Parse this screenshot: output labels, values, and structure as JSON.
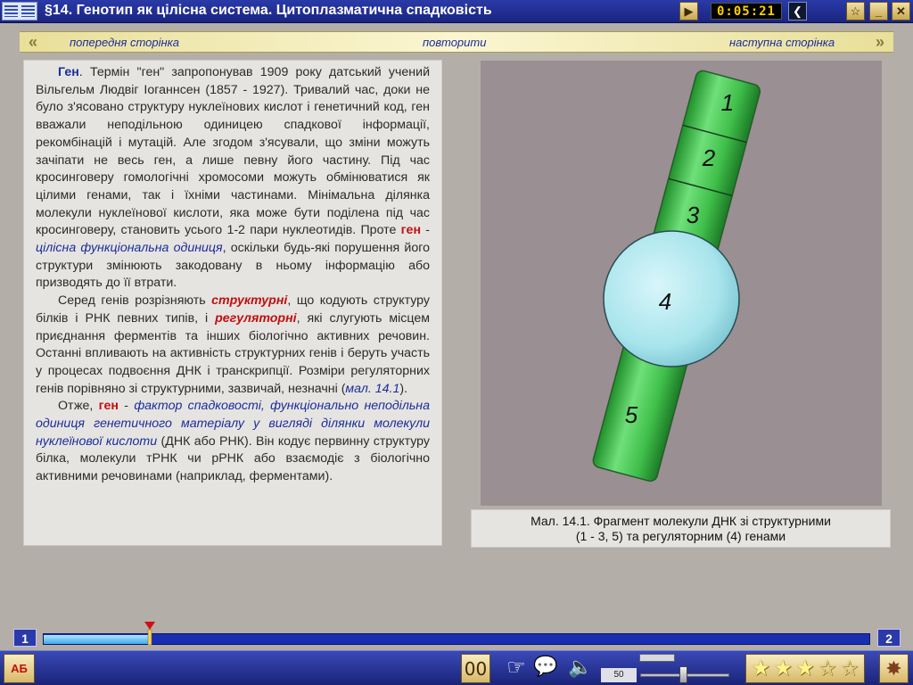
{
  "window": {
    "title": "§14. Генотип як цілісна система. Цитоплазматична спадковість",
    "timer": "0:05:21"
  },
  "nav": {
    "prev": "попередня сторінка",
    "repeat": "повторити",
    "next": "наступна сторінка"
  },
  "text": {
    "p1_gen": "Ген",
    "p1_a": ". Термін \"ген\" запропонував 1909 року датський учений Вільгельм Людвіг Іоганнсен (1857 - 1927). Тривалий час, доки не було з'ясовано структуру нуклеїнових кислот і генетичний код, ген вважали неподільною одиницею спадкової інформації, рекомбінацій і мутацій. Але згодом з'ясували, що зміни можуть зачіпати не весь ген, а лише певну його частину. Під час кросинговеру гомологічні хромосоми можуть обмінюватися як цілими генами, так і їхніми частинами. Мінімальна ділянка молекули нуклеїнової кислоти, яка може бути поділена під час кросинговеру, становить усього 1-2 пари нуклеотидів. Проте ",
    "p1_gen2": "ген",
    "p1_b": " - ",
    "p1_def": "цілісна функціональна одиниця",
    "p1_c": ", оскільки будь-які порушення його структури змінюють закодовану в ньому інформацію або призводять до її втрати.",
    "p2_a": "Серед генів розрізняють ",
    "p2_struct": "структурні",
    "p2_b": ", що кодують структуру білків і РНК певних типів, і ",
    "p2_reg": "регуляторні",
    "p2_c": ", які слугують місцем приєднання ферментів та інших біологічно активних речовин. Останні впливають на активність структурних генів і беруть участь у процесах подвоєння ДНК і транскрипції. Розміри регуляторних генів порівняно зі структурними, зазвичай, незначні (",
    "p2_ref": "мал. 14.1",
    "p2_d": ").",
    "p3_a": "Отже, ",
    "p3_gen": "ген",
    "p3_b": " - ",
    "p3_def": "фактор спадковості, функціонально неподільна одиниця генетичного матеріалу у вигляді ділянки молекули нуклеїнової кислоти",
    "p3_c": " (ДНК або РНК). Він кодує первинну структуру білка, молекули тРНК чи рРНК або взаємодіє з біологічно активними речовинами (наприклад, ферментами)."
  },
  "figure": {
    "segments": [
      "1",
      "2",
      "3",
      "4",
      "5"
    ],
    "caption_line1": "Мал. 14.1. Фрагмент молекули ДНК зі структурними",
    "caption_line2": "(1 - 3, 5) та регуляторним (4) генами"
  },
  "progress": {
    "start_page": "1",
    "end_page": "2",
    "fraction": 0.13
  },
  "toolbar": {
    "spell_label": "АБ",
    "counter": "00",
    "volume_value": "50",
    "stars_filled": 3,
    "stars_total": 5
  },
  "colors": {
    "title_bg": "#1a2480",
    "accent_blue": "#1a2d9a",
    "accent_red": "#c01010",
    "gene_green": "#3fbf4a",
    "regulator_cyan": "#a8e4ec",
    "figure_bg": "#9a8f92"
  },
  "icons": [
    "menu-icon",
    "play-icon",
    "back-icon",
    "star-icon",
    "minimize-icon",
    "close-icon",
    "hand-icon",
    "speech-icon",
    "speaker-icon",
    "fan-icon"
  ]
}
